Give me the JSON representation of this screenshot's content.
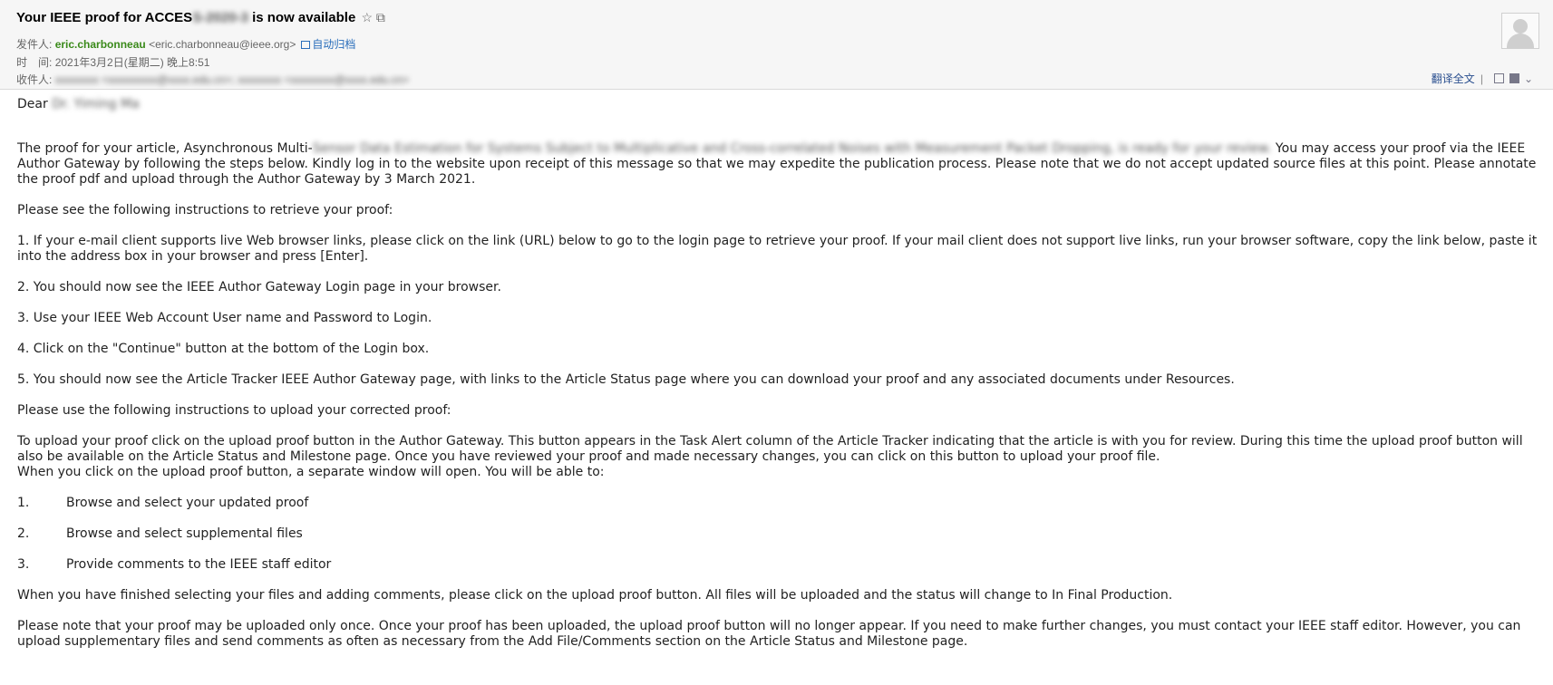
{
  "header": {
    "subject_prefix": "Your IEEE proof for ACCES",
    "subject_blur": "S-2020-3",
    "subject_suffix": " is now available",
    "star_icon": "☆",
    "popout_icon": "⧉",
    "from_label": "发件人:",
    "sender_name": "eric.charbonneau",
    "sender_email": "<eric.charbonneau@ieee.org>",
    "archive_label": "自动归档",
    "time_label": "时　间:",
    "time_value": "2021年3月2日(星期二) 晚上8:51",
    "to_label": "收件人:",
    "to_blur": "xxxxxxxx <xxxxxxxxx@xxxx.edu.cn>; xxxxxxxx <xxxxxxxx@xxxx.edu.cn>",
    "translate_label": "翻译全文",
    "divider": "|"
  },
  "body": {
    "greeting_prefix": "Dear ",
    "greeting_blur": "Dr. Yiming Ma",
    "p1_a": "The proof for your article, Asynchronous Multi-",
    "p1_blur": "Sensor Data Estimation for Systems Subject to Multiplicative and Cross-correlated Noises with Measurement Packet Dropping, is ready for your review.",
    "p1_b": " You may access your proof via the IEEE Author Gateway by following the steps below. Kindly log in to the website upon receipt of this message so that we may expedite the publication process. Please note that we do not accept updated source files at this point. Please annotate the proof pdf and upload through the Author Gateway by 3 March 2021.",
    "p2": "Please see the following instructions to retrieve your proof:",
    "p3": "1. If your e-mail client supports live Web browser links, please click on the link (URL) below to go to the login page to retrieve your proof.  If your mail client does not support live links, run your browser software, copy the link below, paste it into the address box in your browser and press [Enter].",
    "p4": "2. You should now see the IEEE Author Gateway Login page in your browser.",
    "p5": "3. Use your IEEE Web Account User name and Password to Login.",
    "p6": "4. Click on the \"Continue\" button at the bottom of the Login box.",
    "p7": "5. You should now see the Article Tracker IEEE Author Gateway page, with links to the Article Status page where you can download your proof and any associated documents under Resources.",
    "p8": "Please use the following instructions to upload your corrected proof:",
    "p9_a": "To upload your proof click on the upload proof button in the Author Gateway. This button appears in the Task Alert column of the Article Tracker indicating that the article is with you for review. During this time the upload proof button will also be available on the Article Status and Milestone page. Once you have reviewed your proof and made necessary changes, you can click on this button to upload your proof file.",
    "p9_b": "When you click on the upload proof button, a separate window will open. You will be able to:",
    "list": [
      {
        "num": "1.",
        "text": "Browse and select your updated proof"
      },
      {
        "num": "2.",
        "text": "Browse and select supplemental files"
      },
      {
        "num": "3.",
        "text": "Provide comments to the IEEE staff editor"
      }
    ],
    "p10": "When you have finished selecting your files and adding comments, please click on the upload proof button. All files will be uploaded and the status will change to In Final Production.",
    "p11": "Please note that your proof may be uploaded only once. Once your proof has been uploaded, the upload proof button will no longer appear. If you need to make further changes, you must contact your IEEE staff editor. However, you can upload supplementary files and send comments as often as necessary from the Add File/Comments section on the Article Status and Milestone page."
  }
}
